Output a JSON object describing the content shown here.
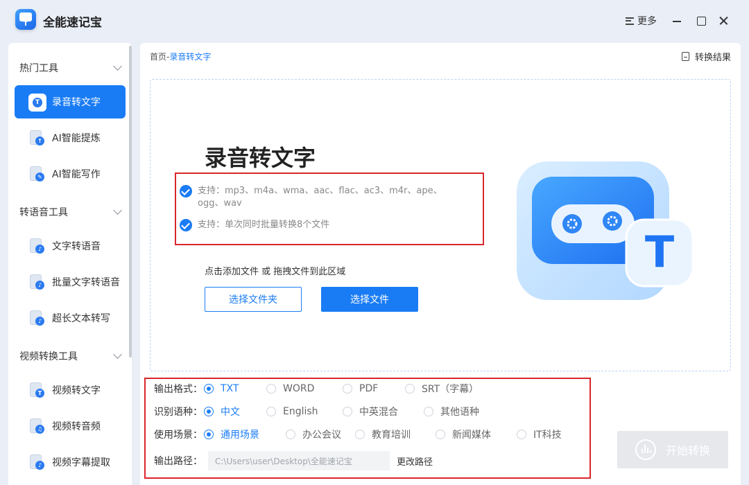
{
  "app": {
    "title": "全能速记宝"
  },
  "titlebar": {
    "more_label": "更多"
  },
  "sidebar": {
    "groups": [
      {
        "label": "热门工具",
        "items": [
          "录音转文字",
          "AI智能提炼",
          "AI智能写作"
        ]
      },
      {
        "label": "转语音工具",
        "items": [
          "文字转语音",
          "批量文字转语音",
          "超长文本转写"
        ]
      },
      {
        "label": "视频转换工具",
        "items": [
          "视频转文字",
          "视频转音频",
          "视频字幕提取"
        ]
      }
    ],
    "active_item": "录音转文字"
  },
  "main": {
    "breadcrumb": {
      "home": "首页",
      "sep": "-",
      "current": "录音转文字"
    },
    "result_link": "转换结果",
    "hero_title": "录音转文字",
    "support": [
      "支持：mp3、m4a、wma、aac、flac、ac3、m4r、ape、ogg、wav",
      "支持：单次同时批量转换8个文件"
    ],
    "hint": "点击添加文件 或 拖拽文件到此区域",
    "btn_folder": "选择文件夹",
    "btn_file": "选择文件"
  },
  "settings": {
    "format": {
      "label": "输出格式：",
      "options": [
        "TXT",
        "WORD",
        "PDF",
        "SRT（字幕）"
      ],
      "selected": "TXT"
    },
    "language": {
      "label": "识别语种：",
      "options": [
        "中文",
        "English",
        "中英混合",
        "其他语种"
      ],
      "selected": "中文"
    },
    "scene": {
      "label": "使用场景：",
      "options": [
        "通用场景",
        "办公会议",
        "教育培训",
        "新闻媒体",
        "IT科技"
      ],
      "selected": "通用场景"
    },
    "path": {
      "label": "输出路径：",
      "value": "C:\\Users\\user\\Desktop\\全能速记宝",
      "change_label": "更改路径"
    }
  },
  "start_button": "开始转换",
  "colors": {
    "accent": "#1a7cf5",
    "highlight_border": "#d9252b",
    "disabled": "#e6e8ec"
  }
}
